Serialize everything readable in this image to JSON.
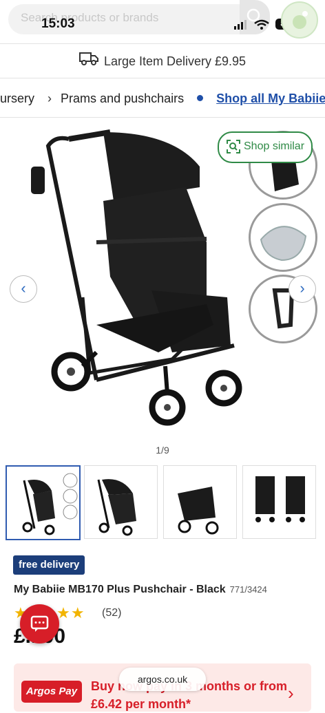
{
  "status": {
    "time": "15:03",
    "battery": "85"
  },
  "search": {
    "placeholder": "Search products or brands"
  },
  "delivery_banner": {
    "text": "Large Item Delivery £9.95",
    "icon": "truck-icon"
  },
  "breadcrumb": {
    "items": [
      "ursery",
      "Prams and pushchairs"
    ],
    "link": "Shop all My Babiie"
  },
  "gallery": {
    "shop_similar": "Shop similar",
    "counter": "1/9"
  },
  "product": {
    "badge": "free delivery",
    "title": "My Babiie MB170 Plus Pushchair - Black",
    "sku": "771/3424",
    "rating": 4.5,
    "stars": "★★★★★",
    "reviews": "(52)",
    "price": "£...00"
  },
  "promo": {
    "logo": "Argos Pay",
    "line1": "Buy now pay in 3 months or from",
    "line2": "£6.42 per month*"
  },
  "browser": {
    "url": "argos.co.uk"
  },
  "colors": {
    "brand_red": "#d71e28",
    "link_blue": "#1f4fa8",
    "accent_green": "#2f8a46"
  }
}
